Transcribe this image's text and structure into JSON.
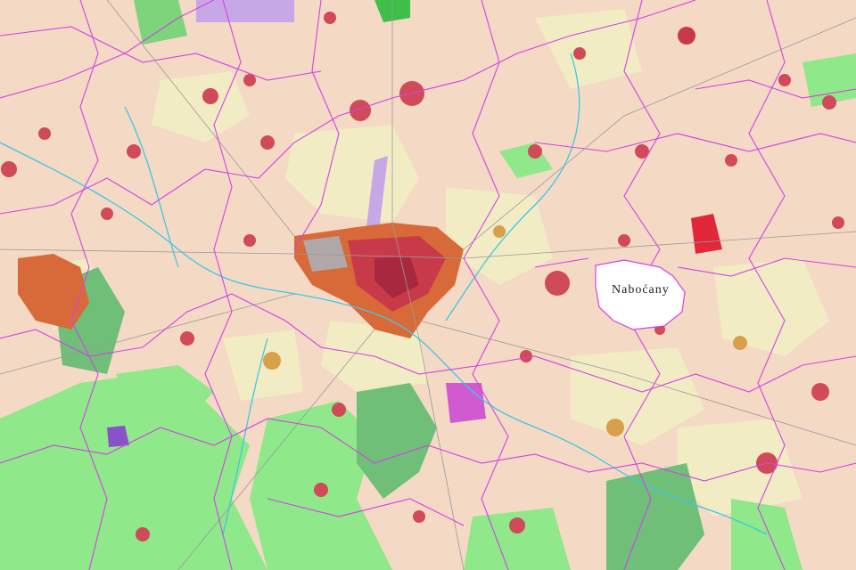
{
  "map": {
    "highlighted_municipality": "Naboćany",
    "colors": {
      "arable": "#f4d9c5",
      "meadow_light": "#f1ecc4",
      "forest": "#8fe88a",
      "forest_dark": "#6fbf78",
      "urban_red": "#c83a4a",
      "urban_orange": "#d86a3a",
      "industrial_purple": "#c068c8",
      "water": "#3cc8e6",
      "boundary": "#d442e6",
      "highlight": "#ffffff"
    }
  }
}
